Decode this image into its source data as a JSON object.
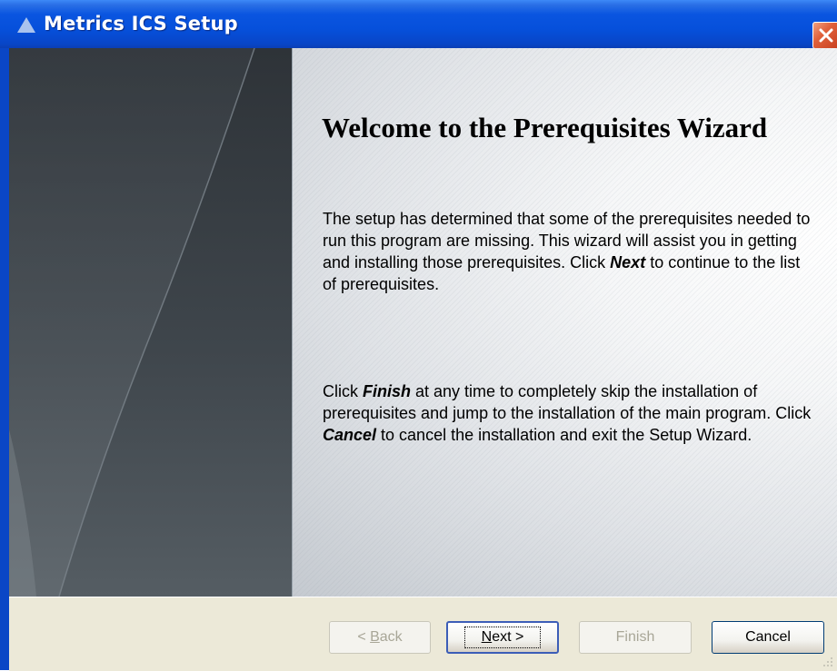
{
  "window": {
    "title": "Metrics ICS Setup"
  },
  "content": {
    "heading": "Welcome to the Prerequisites Wizard",
    "paragraph1": {
      "before": "The setup has determined that some of the prerequisites needed to run this program are missing. This wizard will assist you in getting and installing those prerequisites. Click ",
      "bold": "Next",
      "after": "  to continue to the list of prerequisites."
    },
    "paragraph2": {
      "part1": "Click ",
      "bold1": "Finish",
      "part2": " at any time to completely skip the installation of prerequisites and jump to the installation of the main program. Click ",
      "bold2": "Cancel",
      "part3": " to cancel the installation and exit the Setup Wizard."
    }
  },
  "buttons": {
    "back_prefix": "< ",
    "back_accel": "B",
    "back_rest": "ack",
    "next_accel": "N",
    "next_rest": "ext >",
    "finish": "Finish",
    "cancel": "Cancel"
  },
  "colors": {
    "titlebar": "#0650db",
    "close_button": "#e0603a",
    "dialog_face": "#ece9d8"
  }
}
